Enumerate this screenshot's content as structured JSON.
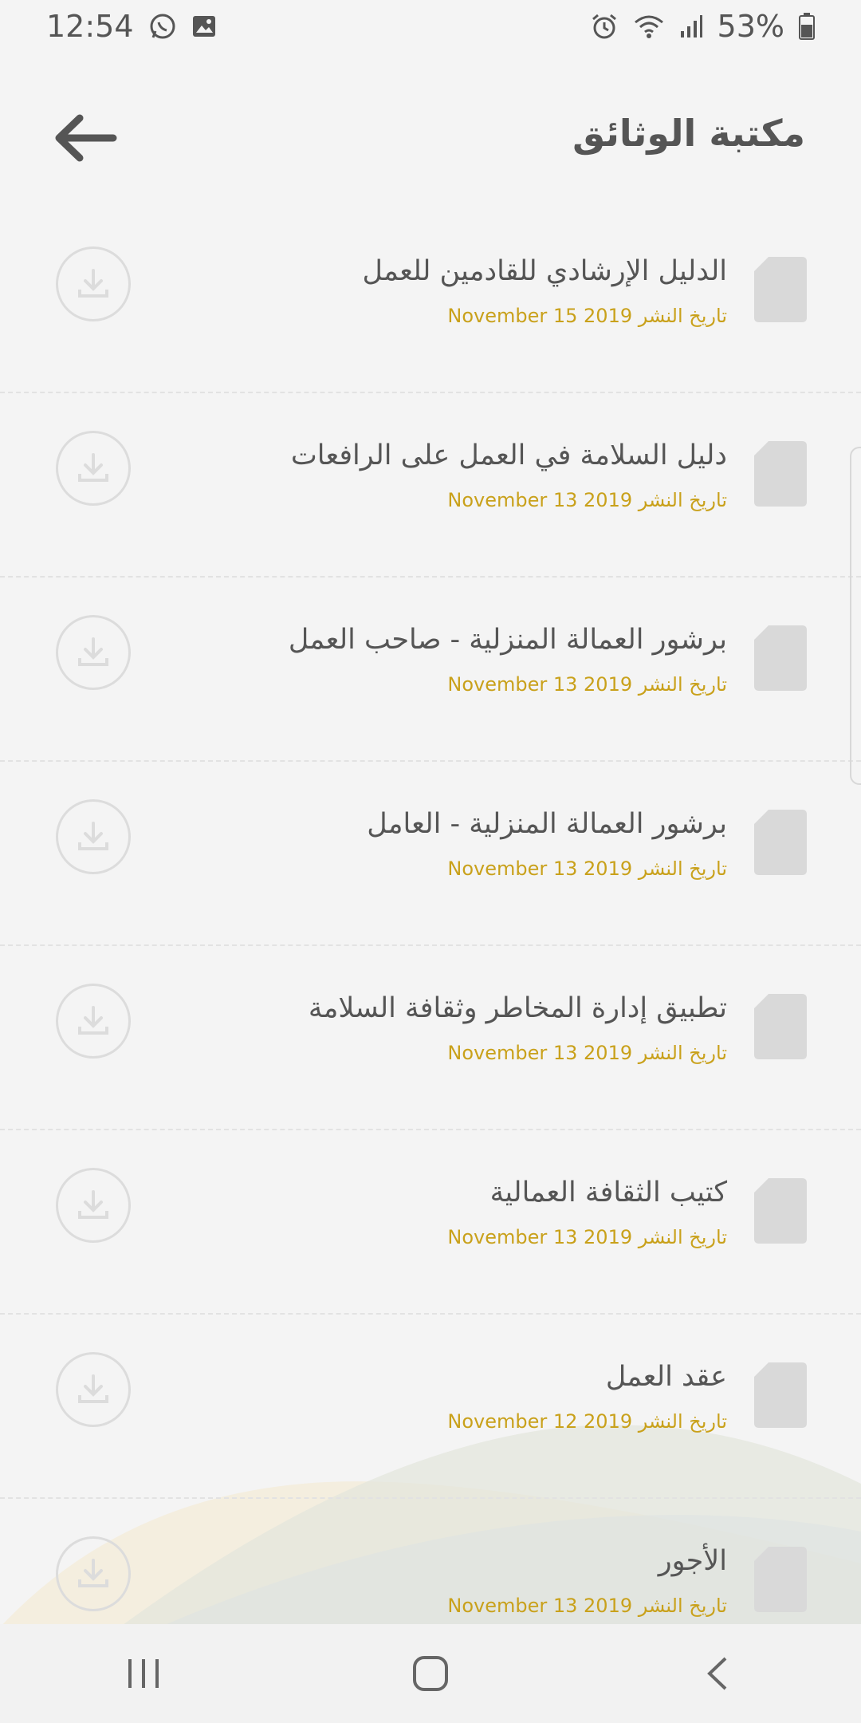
{
  "status_bar": {
    "time": "12:54",
    "battery": "53%",
    "icons_left": [
      "whatsapp-icon",
      "gallery-icon"
    ],
    "icons_right": [
      "alarm-icon",
      "wifi-icon",
      "signal-icon",
      "battery-icon"
    ]
  },
  "header": {
    "title": "مكتبة الوثائق",
    "back_icon": "arrow-left-icon"
  },
  "documents": [
    {
      "title": "الدليل الإرشادي للقادمين للعمل",
      "date": "تاريخ النشر November 15 2019"
    },
    {
      "title": "دليل السلامة في العمل على الرافعات",
      "date": "تاريخ النشر November 13 2019"
    },
    {
      "title": "برشور العمالة المنزلية - صاحب العمل",
      "date": "تاريخ النشر November 13 2019"
    },
    {
      "title": "برشور العمالة المنزلية - العامل",
      "date": "تاريخ النشر November 13 2019"
    },
    {
      "title": "تطبيق إدارة المخاطر وثقافة السلامة",
      "date": "تاريخ النشر November 13 2019"
    },
    {
      "title": "كتيب الثقافة العمالية",
      "date": "تاريخ النشر November 13 2019"
    },
    {
      "title": "عقد العمل",
      "date": "تاريخ النشر November 12 2019"
    },
    {
      "title": "الأجور",
      "date": "تاريخ النشر November 13 2019"
    }
  ],
  "colors": {
    "accent_date": "#c9a11b",
    "text": "#555555",
    "icon_gray": "#d9d9d9"
  },
  "nav_bar": {
    "icons": [
      "recent-apps-icon",
      "home-icon",
      "back-icon"
    ]
  }
}
